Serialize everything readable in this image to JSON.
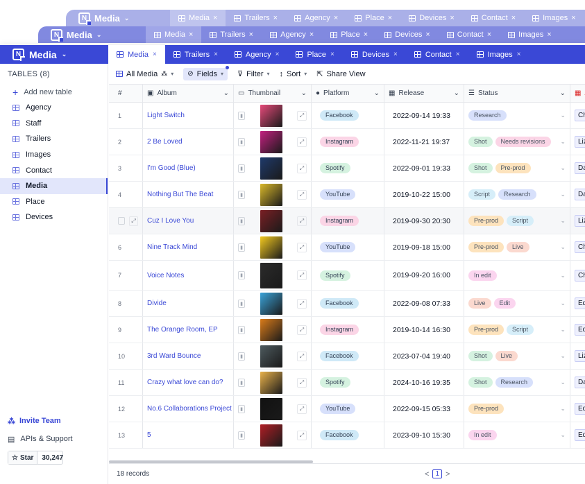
{
  "app": {
    "name": "Media",
    "tabs": [
      {
        "label": "Media",
        "active": true
      },
      {
        "label": "Trailers"
      },
      {
        "label": "Agency"
      },
      {
        "label": "Place"
      },
      {
        "label": "Devices"
      },
      {
        "label": "Contact"
      },
      {
        "label": "Images"
      }
    ],
    "close_glyph": "×"
  },
  "sidebar": {
    "title": "TABLES (8)",
    "add_label": "Add new table",
    "items": [
      "Agency",
      "Staff",
      "Trailers",
      "Images",
      "Contact",
      "Media",
      "Place",
      "Devices"
    ],
    "active": "Media",
    "invite": "Invite Team",
    "apis": "APIs & Support",
    "star_label": "Star",
    "star_count": "30,247"
  },
  "toolbar": {
    "view": "All Media",
    "fields": "Fields",
    "filter": "Filter",
    "sort": "Sort",
    "share": "Share View"
  },
  "table": {
    "columns": [
      "#",
      "Album",
      "Thumbnail",
      "Platform",
      "Release",
      "Status",
      "A"
    ],
    "rows": [
      {
        "n": "1",
        "album": "Light Switch",
        "thumb": "#e64a7a",
        "platform": "Facebook",
        "release": "2022-09-14 19:33",
        "status": [
          "Research"
        ],
        "person": "Cha"
      },
      {
        "n": "2",
        "album": "2 Be Loved",
        "thumb": "#c2207f",
        "platform": "Instagram",
        "release": "2022-11-21 19:37",
        "status": [
          "Shot",
          "Needs revisions"
        ],
        "person": "Lizz"
      },
      {
        "n": "3",
        "album": "I'm Good (Blue)",
        "thumb": "#1f3a6b",
        "platform": "Spotify",
        "release": "2022-09-01 19:33",
        "status": [
          "Shot",
          "Pre-prod"
        ],
        "person": "Dav"
      },
      {
        "n": "4",
        "album": "Nothing But The Beat",
        "thumb": "#d9b82a",
        "platform": "YouTube",
        "release": "2019-10-22 15:00",
        "status": [
          "Script",
          "Research"
        ],
        "person": "Dav"
      },
      {
        "n": "",
        "album": "Cuz I Love You",
        "thumb": "#7a1f24",
        "platform": "Instagram",
        "release": "2019-09-30 20:30",
        "status": [
          "Pre-prod",
          "Script"
        ],
        "person": "Lizz"
      },
      {
        "n": "6",
        "album": "Nine Track Mind",
        "thumb": "#f2c81f",
        "platform": "YouTube",
        "release": "2019-09-18 15:00",
        "status": [
          "Pre-prod",
          "Live"
        ],
        "person": "Cha"
      },
      {
        "n": "7",
        "album": "Voice Notes",
        "thumb": "#2b2b2b",
        "platform": "Spotify",
        "release": "2019-09-20 16:00",
        "status": [
          "In edit"
        ],
        "person": "Cha"
      },
      {
        "n": "8",
        "album": "Divide",
        "thumb": "#3aa3d9",
        "platform": "Facebook",
        "release": "2022-09-08 07:33",
        "status": [
          "Live",
          "Edit"
        ],
        "person": "Ed S"
      },
      {
        "n": "9",
        "album": "The Orange Room, EP",
        "thumb": "#d97b1a",
        "platform": "Instagram",
        "release": "2019-10-14 16:30",
        "status": [
          "Pre-prod",
          "Script"
        ],
        "person": "Ed S"
      },
      {
        "n": "10",
        "album": "3rd Ward Bounce",
        "thumb": "#4d5a5e",
        "platform": "Facebook",
        "release": "2023-07-04 19:40",
        "status": [
          "Shot",
          "Live"
        ],
        "person": "Lizz"
      },
      {
        "n": "11",
        "album": "Crazy what love can do?",
        "thumb": "#e8b14a",
        "platform": "Spotify",
        "release": "2024-10-16 19:35",
        "status": [
          "Shot",
          "Research"
        ],
        "person": "Dav"
      },
      {
        "n": "12",
        "album": "No.6 Collaborations Project",
        "thumb": "#111111",
        "platform": "YouTube",
        "release": "2022-09-15 05:33",
        "status": [
          "Pre-prod"
        ],
        "person": "Ed S"
      },
      {
        "n": "13",
        "album": "5",
        "thumb": "#b01e25",
        "platform": "Facebook",
        "release": "2023-09-10 15:30",
        "status": [
          "In edit"
        ],
        "person": "Ed S"
      }
    ]
  },
  "footer": {
    "records": "18 records",
    "page": "1",
    "prev": "<",
    "next": ">"
  },
  "colors": {
    "accent": "#3a48d6",
    "platform": {
      "Facebook": "#cfe9f7",
      "Instagram": "#fbd5e6",
      "Spotify": "#d5f2e0",
      "YouTube": "#d7e0fb"
    },
    "status": {
      "Research": "#d7e0fb",
      "Shot": "#d5f2e0",
      "Needs revisions": "#fbd5e6",
      "Pre-prod": "#fde3bd",
      "Script": "#d6eef9",
      "In edit": "#fbd5ef",
      "Live": "#fbd9cf",
      "Edit": "#fbd5ef"
    }
  }
}
